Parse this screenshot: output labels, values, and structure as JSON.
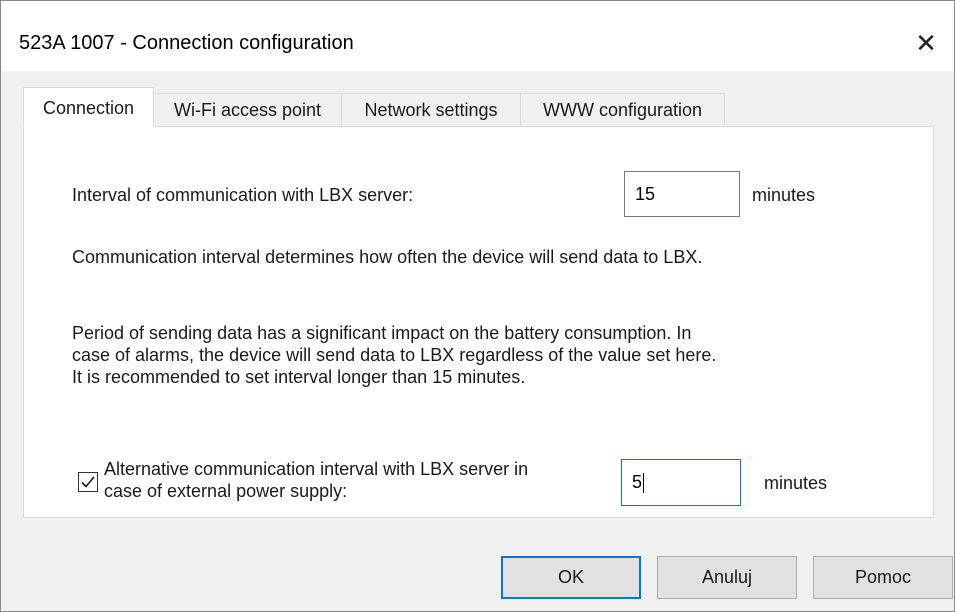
{
  "window": {
    "title": "523A 1007 - Connection configuration",
    "close_glyph": "✕"
  },
  "tabs": [
    {
      "label": "Connection",
      "active": true
    },
    {
      "label": "Wi-Fi access point",
      "active": false
    },
    {
      "label": "Network settings",
      "active": false
    },
    {
      "label": "WWW configuration",
      "active": false
    }
  ],
  "connection": {
    "interval_label": "Interval of communication with LBX server:",
    "interval_value": "15",
    "interval_unit": "minutes",
    "info_text": "Communication interval determines how often the device will send data to LBX.",
    "battery_line1": "Period of sending data has a significant impact on the battery consumption. In",
    "battery_line2": "case of alarms, the device will send data to LBX regardless of the value set here.",
    "battery_line3": "It is recommended to set interval longer than 15 minutes.",
    "alt_checked": true,
    "alt_label_line1": "Alternative communication interval with LBX server in",
    "alt_label_line2": "case of external power supply:",
    "alt_value": "5",
    "alt_unit": "minutes"
  },
  "buttons": {
    "ok": "OK",
    "cancel": "Anuluj",
    "help": "Pomoc"
  },
  "colors": {
    "focus_accent": "#0078d7",
    "dialog_bg": "#f0f0f0"
  }
}
